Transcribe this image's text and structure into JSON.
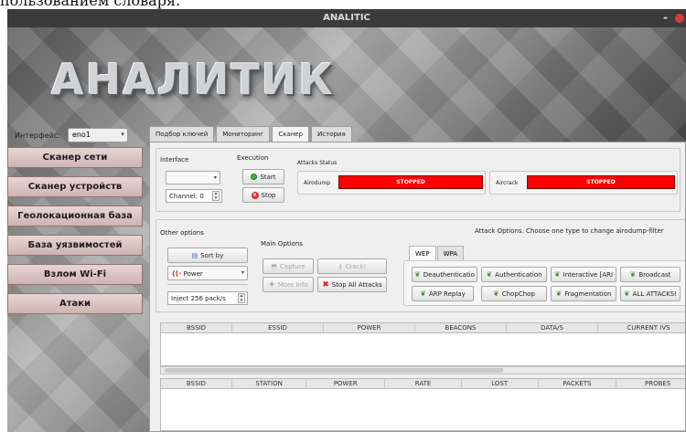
{
  "caption_fragment": "пользованием словаря.",
  "window": {
    "title": "ANALITIC",
    "minimize_glyph": "-"
  },
  "logo": "АНАЛИТИК",
  "interface_bar": {
    "label": "Интерфейс:",
    "value": "eno1"
  },
  "sidebar": {
    "items": [
      {
        "label": "Сканер сети"
      },
      {
        "label": "Сканер устройств"
      },
      {
        "label": "Геолокационная база"
      },
      {
        "label": "База уязвимостей"
      },
      {
        "label": "Взлом Wi-Fi"
      },
      {
        "label": "Атаки"
      }
    ]
  },
  "tabs": [
    {
      "label": "Подбор ключей",
      "active": false
    },
    {
      "label": "Мониторинг",
      "active": false
    },
    {
      "label": "Сканер",
      "active": true
    },
    {
      "label": "История",
      "active": false
    }
  ],
  "scanner": {
    "interface_group": {
      "label": "Interface",
      "select_value": "",
      "channel_label": "Channel: 0"
    },
    "execution_group": {
      "label": "Execution",
      "start_label": "Start",
      "stop_label": "Stop"
    },
    "attacks_status": {
      "label": "Attacks Status",
      "airodump_label": "Airodump",
      "airodump_status": "STOPPED",
      "aircrack_label": "Aircrack",
      "aircrack_status": "STOPPED"
    },
    "other_options": {
      "label": "Other options",
      "sort_label": "Sort by",
      "power_label": "Power",
      "inject_label": "Inject 256 pack/s"
    },
    "main_options": {
      "label": "Main Options",
      "capture_label": "Capture",
      "crack_label": "Crack!",
      "more_info_label": "More Info",
      "stop_all_label": "Stop All Attacks"
    },
    "attack_options": {
      "label": "Attack Options. Choose one type to change airodump-filter",
      "tabs": [
        "WEP",
        "WPA"
      ],
      "buttons_row1": [
        "Deauthenticatio",
        "Authentication",
        "Interactive [ARI",
        "Broadcast"
      ],
      "buttons_row2": [
        "ARP Replay",
        "ChopChop",
        "Fragmentation",
        "ALL ATTACKS!"
      ]
    },
    "ap_table": {
      "headers": [
        "BSSID",
        "ESSID",
        "POWER",
        "BEACONS",
        "DATA/S",
        "CURRENT IVS"
      ]
    },
    "client_table": {
      "headers": [
        "BSSID",
        "STATION",
        "POWER",
        "RATE",
        "LOST",
        "PACKETS",
        "PROBES"
      ]
    }
  },
  "colors": {
    "status_red": "#ff0000",
    "sidebar_button": "#d9c0c0",
    "panel_bg": "#efefef"
  }
}
